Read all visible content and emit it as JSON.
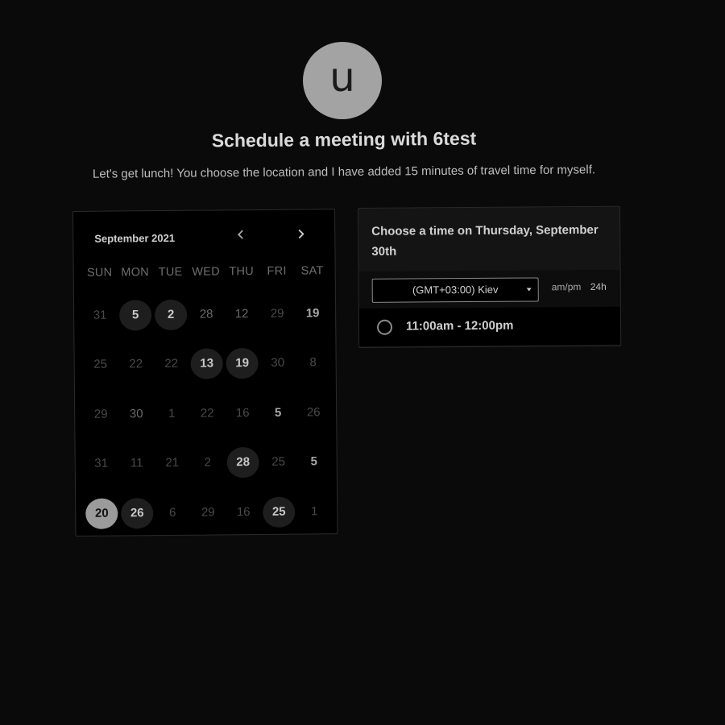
{
  "profile": {
    "avatar_letter": "u",
    "title": "Schedule a meeting with 6test",
    "description": "Let's get lunch! You choose the location and I have added 15 minutes of travel time for myself."
  },
  "calendar": {
    "month_label": "September 2021",
    "weekdays": [
      "SUN",
      "MON",
      "TUE",
      "WED",
      "THU",
      "FRI",
      "SAT"
    ],
    "weeks": [
      [
        {
          "label": "31",
          "state": "muted"
        },
        {
          "label": "5",
          "state": "avail"
        },
        {
          "label": "2",
          "state": "avail"
        },
        {
          "label": "28",
          "state": "plain"
        },
        {
          "label": "12",
          "state": "plain"
        },
        {
          "label": "29",
          "state": "muted"
        },
        {
          "label": "19",
          "state": "bold"
        }
      ],
      [
        {
          "label": "25",
          "state": "muted"
        },
        {
          "label": "22",
          "state": "muted"
        },
        {
          "label": "22",
          "state": "muted"
        },
        {
          "label": "13",
          "state": "avail"
        },
        {
          "label": "19",
          "state": "avail"
        },
        {
          "label": "30",
          "state": "muted"
        },
        {
          "label": "8",
          "state": "muted"
        }
      ],
      [
        {
          "label": "29",
          "state": "muted"
        },
        {
          "label": "30",
          "state": "plain"
        },
        {
          "label": "1",
          "state": "muted"
        },
        {
          "label": "22",
          "state": "muted"
        },
        {
          "label": "16",
          "state": "muted"
        },
        {
          "label": "5",
          "state": "bold"
        },
        {
          "label": "26",
          "state": "muted"
        }
      ],
      [
        {
          "label": "31",
          "state": "muted"
        },
        {
          "label": "11",
          "state": "muted"
        },
        {
          "label": "21",
          "state": "muted"
        },
        {
          "label": "2",
          "state": "muted"
        },
        {
          "label": "28",
          "state": "avail"
        },
        {
          "label": "25",
          "state": "muted"
        },
        {
          "label": "5",
          "state": "bold"
        }
      ],
      [
        {
          "label": "20",
          "state": "selected"
        },
        {
          "label": "26",
          "state": "avail"
        },
        {
          "label": "6",
          "state": "muted"
        },
        {
          "label": "29",
          "state": "muted"
        },
        {
          "label": "16",
          "state": "muted"
        },
        {
          "label": "25",
          "state": "avail"
        },
        {
          "label": "1",
          "state": "muted"
        }
      ]
    ]
  },
  "time_panel": {
    "title": "Choose a time on Thursday, September 30th",
    "timezone": "(GMT+03:00) Kiev",
    "format_ampm": "am/pm",
    "format_24h": "24h",
    "slots": [
      {
        "label": "11:00am - 12:00pm"
      }
    ]
  },
  "colors": {
    "background": "#0a0a0a",
    "selected_day": "#9b9b9b",
    "available_day": "#1e1e1e"
  }
}
